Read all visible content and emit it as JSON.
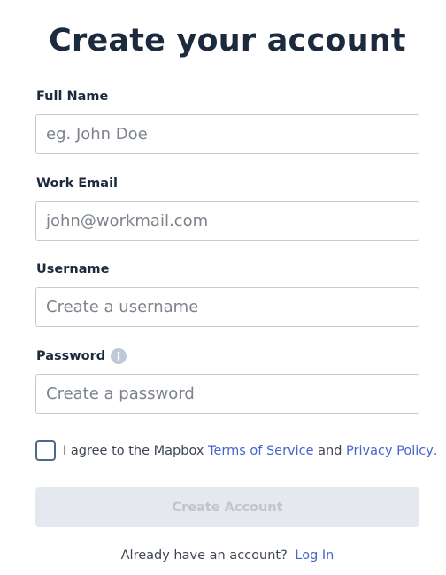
{
  "form": {
    "title": "Create your account",
    "full_name": {
      "label": "Full Name",
      "placeholder": "eg. John Doe",
      "value": ""
    },
    "work_email": {
      "label": "Work Email",
      "placeholder": "john@workmail.com",
      "value": ""
    },
    "username": {
      "label": "Username",
      "placeholder": "Create a username",
      "value": ""
    },
    "password": {
      "label": "Password",
      "placeholder": "Create a password",
      "value": "",
      "info_icon": "info-icon"
    },
    "agreement": {
      "checked": false,
      "prefix": "I agree to the Mapbox ",
      "terms_link": "Terms of Service",
      "middle": " and ",
      "privacy_link": "Privacy Policy",
      "suffix": "."
    },
    "submit_label": "Create Account",
    "login_prompt": "Already have an account?",
    "login_link": "Log In"
  },
  "colors": {
    "heading": "#1c2a3e",
    "link": "#4565c9",
    "input_border": "#c7cbd1",
    "button_disabled_bg": "#e5e8ee",
    "button_disabled_text": "#c2c6cc",
    "checkbox_border": "#4d6a8a",
    "info_icon": "#bfc8d6"
  }
}
